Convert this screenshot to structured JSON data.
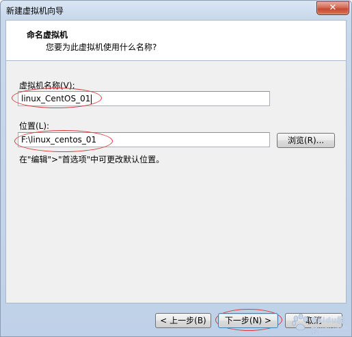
{
  "window": {
    "title": "新建虚拟机向导",
    "close_symbol": "✕"
  },
  "header": {
    "title": "命名虚拟机",
    "subtitle": "您要为此虚拟机使用什么名称?"
  },
  "form": {
    "name_label": "虚拟机名称(V):",
    "name_value": "linux_CentOS_01",
    "location_label": "位置(L):",
    "location_value": "F:\\linux_centos_01",
    "browse_label": "浏览(R)...",
    "hint": "在\"编辑\">\"首选项\"中可更改默认位置。"
  },
  "footer": {
    "back_label": "< 上一步(B)",
    "next_label": "下一步(N) >",
    "cancel_label": "取消"
  },
  "watermark": {
    "text": "Baidu经验",
    "sub": "jingyan.baidu.com"
  },
  "colors": {
    "annotation": "#d9383a",
    "title_bar": "#c9d9ec",
    "close_button": "#c44a32"
  }
}
